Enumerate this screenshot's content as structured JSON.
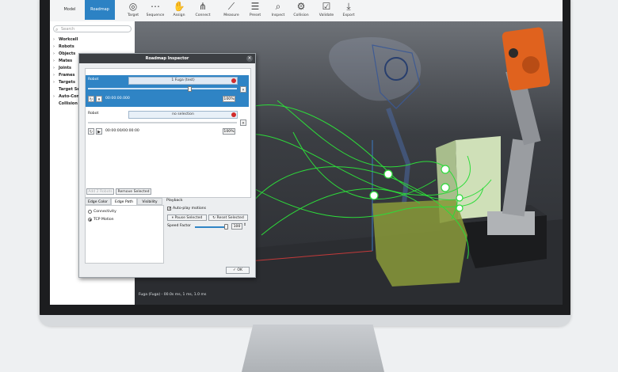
{
  "toolbar": {
    "tabs": [
      {
        "label": "Model"
      },
      {
        "label": "Roadmap"
      }
    ],
    "tools": [
      {
        "label": "Target",
        "icon": "target-icon"
      },
      {
        "label": "Sequence",
        "icon": "sequence-icon"
      },
      {
        "label": "Assign",
        "icon": "assign-icon"
      },
      {
        "label": "Connect",
        "icon": "connect-icon"
      },
      {
        "label": "Measure",
        "icon": "ruler-icon"
      },
      {
        "label": "Preset",
        "icon": "sliders-icon"
      },
      {
        "label": "Inspect",
        "icon": "inspect-icon"
      },
      {
        "label": "Collision",
        "icon": "collision-icon"
      },
      {
        "label": "Validate",
        "icon": "validate-icon"
      },
      {
        "label": "Export",
        "icon": "export-icon"
      }
    ]
  },
  "tree": {
    "search_placeholder": "Search",
    "items": [
      {
        "label": "Workcell",
        "expandable": true
      },
      {
        "label": "Robots",
        "expandable": true
      },
      {
        "label": "Objects",
        "expandable": true
      },
      {
        "label": "Mates",
        "expandable": true
      },
      {
        "label": "Joints",
        "expandable": true
      },
      {
        "label": "Frames",
        "expandable": true
      },
      {
        "label": "Targets",
        "expandable": true
      },
      {
        "label": "Target Se",
        "expandable": false
      },
      {
        "label": "Auto-Con",
        "expandable": true
      },
      {
        "label": "Collision",
        "expandable": false
      }
    ]
  },
  "dialog": {
    "title": "Roadmap Inspector",
    "robot1": {
      "label": "Robot",
      "value": "1 Fuga (test)",
      "time": "00:00:00.000",
      "percent": "100%"
    },
    "robot2": {
      "label": "Robot",
      "value": "no selection",
      "time": "00:00:00/00:00:00",
      "percent": "100%"
    },
    "buttons": {
      "add": "Add 2 Robots",
      "remove": "Remove Selected",
      "ok": "OK"
    },
    "tabs": [
      {
        "label": "Edge Color"
      },
      {
        "label": "Edge Path"
      },
      {
        "label": "Visibility"
      }
    ],
    "edge_path": {
      "connectivity": "Connectivity",
      "tcp_motion": "TCP Motion"
    },
    "playback": {
      "title": "Playback",
      "autoplay": "Auto-play motions",
      "pause": "Pause Selected",
      "reset": "Reset Selected",
      "speed_label": "Speed Factor",
      "speed_value": "100"
    }
  },
  "viewport": {
    "status": "Fuga (Fuga) - 00.0s ms, 1 ms, 1.0 ms"
  },
  "colors": {
    "accent": "#2c82c4",
    "robot_orange": "#e0621e",
    "path_green": "#2ddb3a",
    "part_olive": "#8a9a3a"
  }
}
